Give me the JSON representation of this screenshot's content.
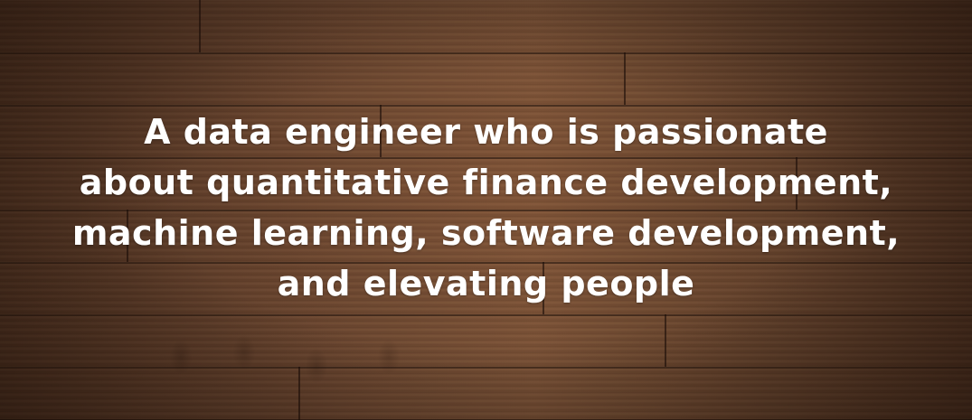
{
  "tagline": {
    "lines": [
      "A data engineer who is passionate",
      "about quantitative finance development,",
      "machine learning, software development,",
      "and elevating people"
    ]
  },
  "colors": {
    "text": "#ffffff",
    "wood_dark": "#4a2f1f",
    "wood_light": "#7a5237"
  }
}
